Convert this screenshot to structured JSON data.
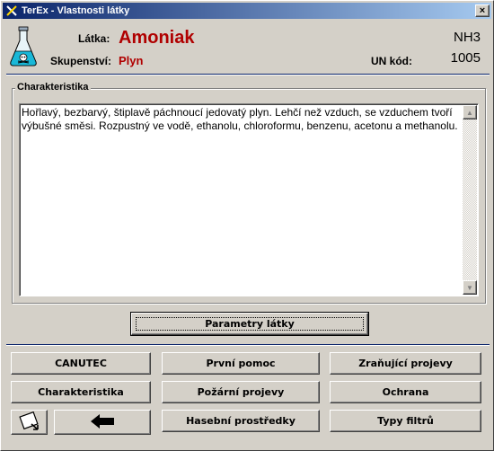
{
  "window": {
    "title": "TerEx - Vlastnosti látky",
    "close_label": "×"
  },
  "substance": {
    "name_label": "Látka:",
    "name": "Amoniak",
    "state_label": "Skupenství:",
    "state": "Plyn",
    "formula": "NH3",
    "un_label": "UN kód:",
    "un_code": "1005"
  },
  "characteristics": {
    "group_label": "Charakteristika",
    "text": "Hořlavý, bezbarvý, štiplavě páchnoucí jedovatý plyn. Lehčí než vzduch, se vzduchem tvoří výbušné směsi. Rozpustný ve vodě, ethanolu, chloroformu, benzenu, acetonu a methanolu."
  },
  "buttons": {
    "parameters": "Parametry látky",
    "canutec": "CANUTEC",
    "first_aid": "První pomoc",
    "injury_effects": "Zraňující projevy",
    "characteristics": "Charakteristika",
    "fire_effects": "Požární projevy",
    "protection": "Ochrana",
    "extinguishing": "Hasební prostředky",
    "filter_types": "Typy filtrů"
  },
  "colors": {
    "accent_red": "#b00000",
    "title_blue": "#0a246a"
  }
}
